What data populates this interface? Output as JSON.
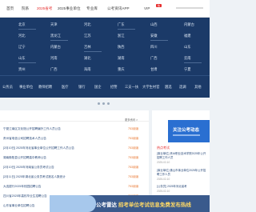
{
  "nav": {
    "items": [
      "首页",
      "院系",
      "2025省考",
      "2025事业单位",
      "专业库",
      "公考资讯APP",
      "VIP"
    ],
    "active_index": 2,
    "vip_badge": "热"
  },
  "regions": [
    [
      "北京",
      "天津",
      "河北",
      "广东",
      "山西",
      "内蒙古"
    ],
    [
      "河北",
      "黑龙江",
      "江苏",
      "浙江",
      "安徽",
      "福建"
    ],
    [
      "辽宁",
      "内蒙古",
      "吉林",
      "陕西",
      "四川",
      "山东"
    ],
    [
      "山东",
      "河南",
      "湖北",
      "湖南",
      "广西",
      "云南"
    ],
    [
      "贵州",
      "广西",
      "海南",
      "重庆",
      "甘肃",
      "宁夏"
    ]
  ],
  "categories": [
    "公务员",
    "事业单位",
    "教师招聘",
    "医疗",
    "银行",
    "国企",
    "招警",
    "三支一扶",
    "大学生村官",
    "遴选",
    "选调",
    "其他"
  ],
  "list": {
    "more": "更多资讯 >",
    "rows": [
      {
        "title": "宁夏江南区文化馆公开招聘编外工作人员公告",
        "count": "753阅读"
      },
      {
        "title": "贵州省电信公司招聘技术人员公告",
        "count": "753阅读"
      },
      {
        "title": "[2月10日] 2025年河北省事业单位公开招聘工作人员公告",
        "count": "753阅读"
      },
      {
        "title": "湖南衡阳县公开招聘高中教师公告",
        "count": "753阅读"
      },
      {
        "title": "[2月10日] 2025年河南省公务员考试公告",
        "count": "753阅读"
      },
      {
        "title": "[2月11日] 2025年湖北省公务员考试报名人数统计",
        "count": "753阅读"
      },
      {
        "title": "大连银行2025年校园招聘公告",
        "count": "753阅读"
      },
      {
        "title": "四川省2025年高校毕业生招聘公告",
        "count": "753阅读"
      },
      {
        "title": "山东省事业单位招聘公告",
        "count": "753阅读"
      }
    ]
  },
  "side": {
    "promo": "关注公考动态",
    "title": "热点考试",
    "items": [
      {
        "text": "[事业单位] 贵州职业技术学院2025年公开招聘工作人员",
        "date": "2025-02-10"
      },
      {
        "text": "[事业单位] 佛山市事业单位2025年公开招聘工作人员",
        "date": "2025-02-10"
      },
      {
        "text": "[公务员] 2025年河北省考",
        "date": "2025-02-10"
      }
    ]
  },
  "banner": {
    "text": "公考雷达",
    "highlight": "招考单位考试信息免费发布热线"
  }
}
